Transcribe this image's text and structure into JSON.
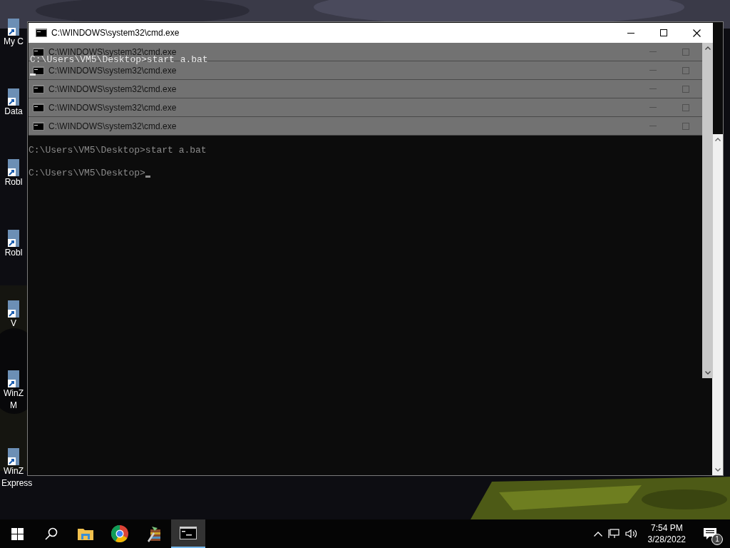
{
  "desktop_icons": [
    {
      "lines": [
        "My C"
      ]
    },
    {
      "lines": [
        "Data"
      ]
    },
    {
      "lines": [
        "Robl"
      ]
    },
    {
      "lines": [
        "Robl"
      ]
    },
    {
      "lines": [
        "V"
      ]
    },
    {
      "lines": [
        "WinZ",
        "M"
      ]
    },
    {
      "lines": [
        "WinZ",
        "Express"
      ]
    }
  ],
  "back_window": {
    "lines": [
      "C:\\Users\\VM5\\Desktop>start a.bat",
      "C:\\Users\\VM5\\Desktop>"
    ]
  },
  "front_window": {
    "title": "C:\\WINDOWS\\system32\\cmd.exe",
    "overlay_line": "C:\\Users\\VM5\\Desktop>start a.bat"
  },
  "ghost_windows": [
    {
      "title": "C:\\WINDOWS\\system32\\cmd.exe"
    },
    {
      "title": "C:\\WINDOWS\\system32\\cmd.exe"
    },
    {
      "title": "C:\\WINDOWS\\system32\\cmd.exe"
    },
    {
      "title": "C:\\WINDOWS\\system32\\cmd.exe"
    },
    {
      "title": "C:\\WINDOWS\\system32\\cmd.exe"
    }
  ],
  "taskbar": {
    "items": [
      {
        "kind": "start",
        "selected": false
      },
      {
        "kind": "search",
        "selected": false
      },
      {
        "kind": "explorer",
        "selected": false
      },
      {
        "kind": "chrome",
        "selected": false
      },
      {
        "kind": "archive",
        "selected": false
      },
      {
        "kind": "cmd",
        "selected": true
      }
    ],
    "time": "7:54 PM",
    "date": "3/28/2022",
    "notifications": "1"
  }
}
